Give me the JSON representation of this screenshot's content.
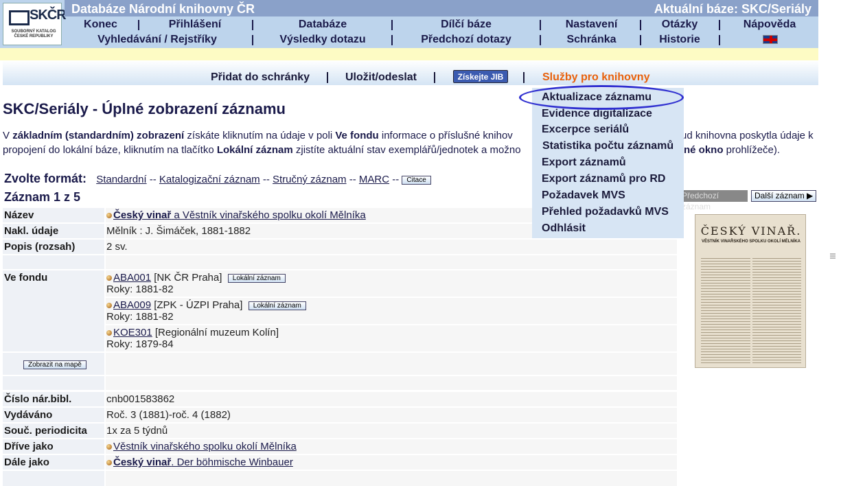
{
  "header": {
    "title": "Databáze Národní knihovny ČR",
    "current_base": "Aktuální báze:  SKC/Seriály",
    "logo_text": "SKČR",
    "logo_sub": "SOUBORNÝ KATALOG ČESKÉ REPUBLIKY",
    "menu1": [
      "Konec",
      "Přihlášení",
      "Databáze",
      "Dílčí báze",
      "Nastavení",
      "Otázky",
      "Nápověda"
    ],
    "menu2": [
      "Vyhledávání / Rejstříky",
      "Výsledky dotazu",
      "Předchozí dotazy",
      "Schránka",
      "Historie"
    ]
  },
  "toolbar": {
    "add": "Přidat do schránky",
    "save": "Uložit/odeslat",
    "jib": "Získejte JIB",
    "services": "Služby pro knihovny"
  },
  "services_menu": [
    "Aktualizace záznamu",
    "Evidence digitalizace",
    "Excerpce seriálů",
    "Statistika počtu záznamů",
    "Export záznamů",
    "Export záznamů pro RD",
    "Požadavek MVS",
    "Přehled požadavků MVS",
    "Odhlásit"
  ],
  "page_title": "SKC/Seriály - Úplné zobrazení záznamu",
  "intro": {
    "p1a": "V ",
    "p1b": "základním (standardním) zobrazení",
    "p1c": " získáte kliknutím na údaje v poli ",
    "p1d": "Ve fondu",
    "p1e": " informace o příslušné knihov",
    "p2a": "propojení do lokální báze, kliknutím na tlačítko ",
    "p2b": "Lokální záznam",
    "p2c": " zjistíte aktuální stav exemplářů/jednotek a možno",
    "p3": "ud knihovna poskytla údaje k",
    "p4a": "né okno",
    "p4b": " prohlížeče)."
  },
  "format": {
    "label": "Zvolte formát:",
    "options": [
      "Standardní",
      "Katalogizační záznam",
      "Stručný záznam",
      "MARC"
    ],
    "sep": "--",
    "citation": "Citace"
  },
  "record": {
    "counter": "Záznam 1 z 5",
    "prev": "Předchozí záznam",
    "next": "Další záznam",
    "thumb_title": "ČESKÝ VINAŘ.",
    "thumb_sub": "VĚSTNÍK VINAŘSKÉHO SPOLKU OKOLÍ MĚLNÍKA"
  },
  "fields": {
    "nazev_label": "Název",
    "nazev_link": "Český vinař",
    "nazev_rest": " a Věstník vinařského spolku okolí Mělníka",
    "nakl_label": "Nakl. údaje",
    "nakl_value": "Mělník : J. Šimáček, 1881-1882",
    "popis_label": "Popis (rozsah)",
    "popis_value": "2 sv.",
    "fond_label": "Ve fondu",
    "holdings": [
      {
        "code": "ABA001",
        "name": " [NK ČR Praha]",
        "years": "Roky: 1881-82"
      },
      {
        "code": "ABA009",
        "name": " [ZPK - ÚZPI Praha]",
        "years": "Roky: 1881-82"
      },
      {
        "code": "KOE301",
        "name": " [Regionální muzeum Kolín]",
        "years": "Roky: 1879-84"
      }
    ],
    "local_btn": "Lokální záznam",
    "map_btn": "Zobrazit na mapě",
    "cnb_label": "Číslo nár.bibl.",
    "cnb_value": "cnb001583862",
    "vyd_label": "Vydáváno",
    "vyd_value": "Roč. 3 (1881)-roč. 4 (1882)",
    "per_label": "Souč. periodicita",
    "per_value": "1x za 5 týdnů",
    "drive_label": "Dříve jako",
    "drive_value": "Věstník vinařského spolku okolí Mělníka",
    "dale_label": "Dále jako",
    "dale_link_bold": "Český vinař",
    "dale_link_rest": ". Der böhmische Winbauer"
  }
}
